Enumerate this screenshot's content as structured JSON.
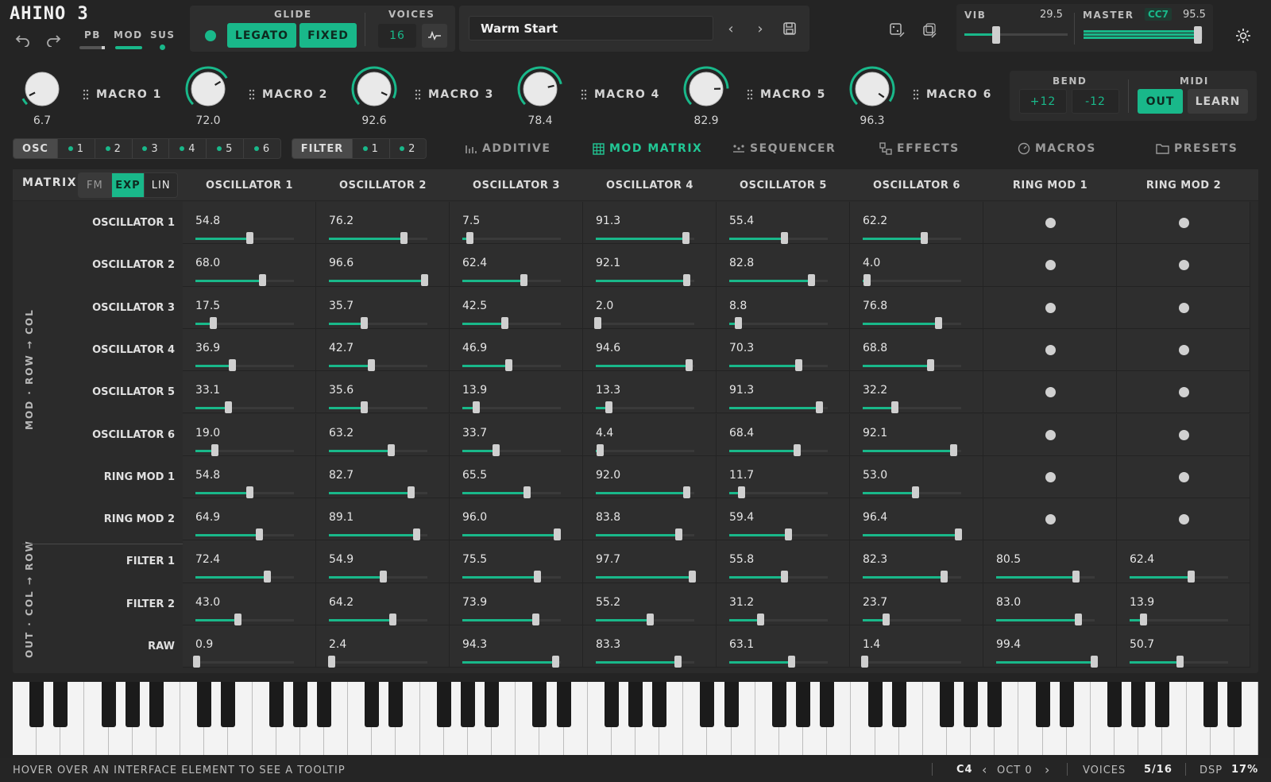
{
  "brand": {
    "logo_text": "AHINO 3"
  },
  "header": {
    "pb_label": "PB",
    "mod_label": "MOD",
    "sus_label": "SUS",
    "glide_label": "GLIDE",
    "legato_label": "LEGATO",
    "fixed_label": "FIXED",
    "voices_label": "VOICES",
    "voices_value": "16",
    "preset_name": "Warm Start",
    "vib_label": "VIB",
    "vib_value": "29.5",
    "vib_fraction": 0.3,
    "master_label": "MASTER",
    "master_cc": "CC7",
    "master_value": "95.5",
    "master_fraction": 0.955
  },
  "macros": [
    {
      "name": "MACRO 1",
      "value": "6.7"
    },
    {
      "name": "MACRO 2",
      "value": "72.0"
    },
    {
      "name": "MACRO 3",
      "value": "92.6"
    },
    {
      "name": "MACRO 4",
      "value": "78.4"
    },
    {
      "name": "MACRO 5",
      "value": "82.9"
    },
    {
      "name": "MACRO 6",
      "value": "96.3"
    }
  ],
  "bend": {
    "label": "BEND",
    "up": "+12",
    "down": "-12"
  },
  "midi": {
    "label": "MIDI",
    "out": "OUT",
    "learn": "LEARN"
  },
  "osc_selector": {
    "label": "OSC",
    "items": [
      "1",
      "2",
      "3",
      "4",
      "5",
      "6"
    ]
  },
  "filter_selector": {
    "label": "FILTER",
    "items": [
      "1",
      "2"
    ]
  },
  "tabs": [
    {
      "label": "ADDITIVE",
      "icon": "bars-icon",
      "active": false
    },
    {
      "label": "MOD MATRIX",
      "icon": "grid-icon",
      "active": true
    },
    {
      "label": "SEQUENCER",
      "icon": "sequencer-icon",
      "active": false
    },
    {
      "label": "EFFECTS",
      "icon": "effects-icon",
      "active": false
    },
    {
      "label": "MACROS",
      "icon": "dial-icon",
      "active": false
    },
    {
      "label": "PRESETS",
      "icon": "folder-icon",
      "active": false
    }
  ],
  "matrix": {
    "label": "MATRIX",
    "modes": [
      "FM",
      "EXP",
      "LIN"
    ],
    "active_mode": "EXP",
    "columns": [
      "OSCILLATOR 1",
      "OSCILLATOR 2",
      "OSCILLATOR 3",
      "OSCILLATOR 4",
      "OSCILLATOR 5",
      "OSCILLATOR 6",
      "RING MOD 1",
      "RING MOD 2"
    ],
    "mod_axis_label": "MOD · ROW → COL",
    "out_axis_label": "OUT · COL → ROW",
    "mod_rows": [
      {
        "label": "OSCILLATOR 1",
        "values": [
          "54.8",
          "76.2",
          "7.5",
          "91.3",
          "55.4",
          "62.2"
        ]
      },
      {
        "label": "OSCILLATOR 2",
        "values": [
          "68.0",
          "96.6",
          "62.4",
          "92.1",
          "82.8",
          "4.0"
        ]
      },
      {
        "label": "OSCILLATOR 3",
        "values": [
          "17.5",
          "35.7",
          "42.5",
          "2.0",
          "8.8",
          "76.8"
        ]
      },
      {
        "label": "OSCILLATOR 4",
        "values": [
          "36.9",
          "42.7",
          "46.9",
          "94.6",
          "70.3",
          "68.8"
        ]
      },
      {
        "label": "OSCILLATOR 5",
        "values": [
          "33.1",
          "35.6",
          "13.9",
          "13.3",
          "91.3",
          "32.2"
        ]
      },
      {
        "label": "OSCILLATOR 6",
        "values": [
          "19.0",
          "63.2",
          "33.7",
          "4.4",
          "68.4",
          "92.1"
        ]
      },
      {
        "label": "RING MOD 1",
        "values": [
          "54.8",
          "82.7",
          "65.5",
          "92.0",
          "11.7",
          "53.0"
        ]
      },
      {
        "label": "RING MOD 2",
        "values": [
          "64.9",
          "89.1",
          "96.0",
          "83.8",
          "59.4",
          "96.4"
        ]
      }
    ],
    "out_rows": [
      {
        "label": "FILTER 1",
        "values": [
          "72.4",
          "54.9",
          "75.5",
          "97.7",
          "55.8",
          "82.3",
          "80.5",
          "62.4"
        ]
      },
      {
        "label": "FILTER 2",
        "values": [
          "43.0",
          "64.2",
          "73.9",
          "55.2",
          "31.2",
          "23.7",
          "83.0",
          "13.9"
        ]
      },
      {
        "label": "RAW",
        "values": [
          "0.9",
          "2.4",
          "94.3",
          "83.3",
          "63.1",
          "1.4",
          "99.4",
          "50.7"
        ]
      }
    ]
  },
  "status": {
    "tooltip": "HOVER OVER AN INTERFACE ELEMENT TO SEE A TOOLTIP",
    "note": "C4",
    "octave": "OCT 0",
    "voices_label": "VOICES",
    "voices_value": "5/16",
    "dsp_label": "DSP",
    "dsp_value": "17%"
  },
  "colors": {
    "accent": "#19b88a",
    "background": "#242424"
  }
}
